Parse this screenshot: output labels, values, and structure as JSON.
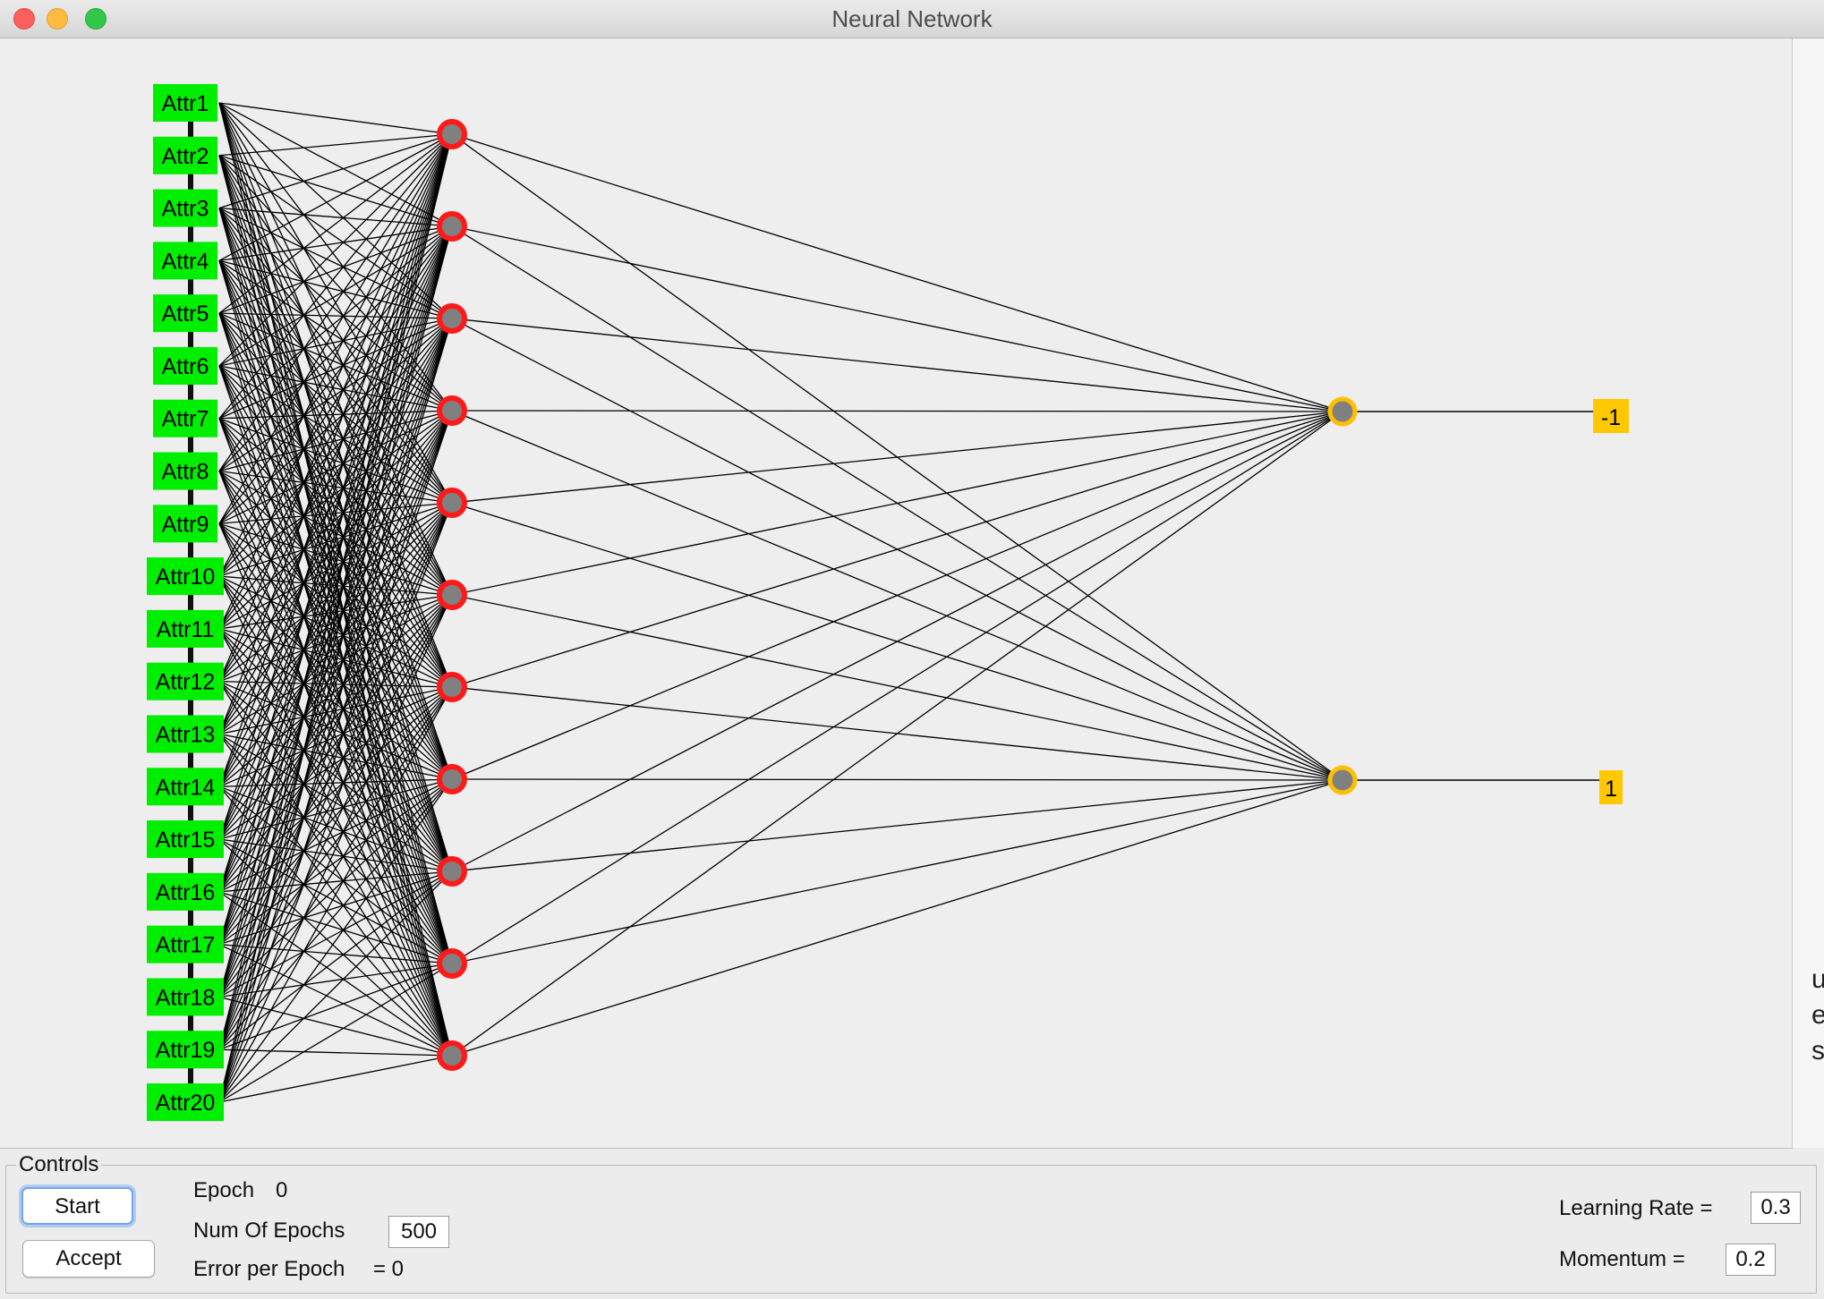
{
  "window": {
    "title": "Neural Network"
  },
  "network": {
    "inputs": [
      "Attr1",
      "Attr2",
      "Attr3",
      "Attr4",
      "Attr5",
      "Attr6",
      "Attr7",
      "Attr8",
      "Attr9",
      "Attr10",
      "Attr11",
      "Attr12",
      "Attr13",
      "Attr14",
      "Attr15",
      "Attr16",
      "Attr17",
      "Attr18",
      "Attr19",
      "Attr20"
    ],
    "hidden_count": 11,
    "output_count": 2,
    "outputs": [
      "-1",
      "1"
    ],
    "colors": {
      "input": "#00ee00",
      "hidden_ring": "#ff1a1a",
      "node_fill": "#808080",
      "output_ring": "#ffc000",
      "output_label": "#ffc800",
      "edge": "#000000"
    }
  },
  "controls": {
    "legend": "Controls",
    "start_label": "Start",
    "accept_label": "Accept",
    "epoch_label": "Epoch",
    "epoch_value": "0",
    "num_epochs_label": "Num Of Epochs",
    "num_epochs_value": "500",
    "error_label": "Error per Epoch",
    "error_value": "= 0",
    "learning_rate_label": "Learning Rate =",
    "learning_rate_value": "0.3",
    "momentum_label": "Momentum =",
    "momentum_value": "0.2"
  },
  "side_glyphs": [
    "u",
    "e",
    "s"
  ]
}
